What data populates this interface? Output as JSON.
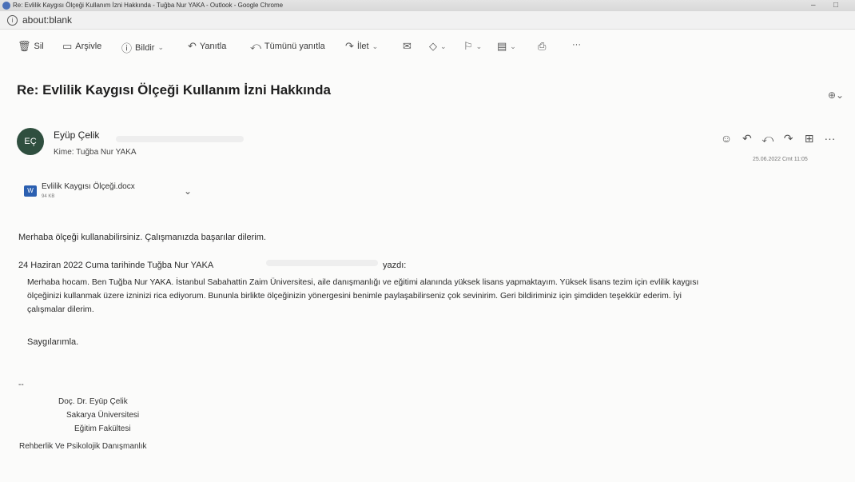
{
  "window": {
    "title": "Re: Evlilik Kaygısı Ölçeği Kullanım İzni Hakkında - Tuğba Nur YAKA - Outlook - Google Chrome",
    "url": "about:blank",
    "minimize": "–",
    "maximize": "□"
  },
  "toolbar": {
    "delete": "Sil",
    "archive": "Arşivle",
    "report": "Bildir",
    "reply": "Yanıtla",
    "reply_all": "Tümünü yanıtla",
    "forward": "İlet",
    "more": "···"
  },
  "mail": {
    "subject": "Re: Evlilik Kaygısı Ölçeği Kullanım İzni Hakkında",
    "avatar_initials": "EÇ",
    "sender": "Eyüp Çelik",
    "to_line": "Kime:  Tuğba Nur YAKA",
    "date": "25.06.2022 Cmt 11:05",
    "attachment": {
      "name": "Evlilik Kaygısı Ölçeği.docx",
      "size": "94 KB"
    },
    "reply_text": "Merhaba ölçeği kullanabilirsiniz. Çalışmanızda başarılar dilerim.",
    "quote_header_start": "24 Haziran 2022 Cuma tarihinde Tuğba Nur YAKA",
    "quote_header_end": "yazdı:",
    "quote_lines": [
      "Merhaba hocam. Ben Tuğba Nur YAKA. İstanbul Sabahattin Zaim Üniversitesi, aile danışmanlığı ve eğitimi alanında yüksek lisans yapmaktayım. Yüksek lisans tezim için evlilik kaygısı",
      "ölçeğinizi kullanmak üzere izninizi rica ediyorum. Bununla birlikte ölçeğinizin yönergesini benimle paylaşabilirseniz çok sevinirim. Geri bildiriminiz için şimdiden teşekkür ederim. İyi",
      "çalışmalar dilerim."
    ],
    "closing": "Saygılarımla.",
    "sig_separator": "--",
    "signature": [
      "Doç. Dr. Eyüp Çelik",
      "Sakarya Üniversitesi",
      "Eğitim Fakültesi",
      "Rehberlik Ve Psikolojik Danışmanlık"
    ]
  },
  "colors": {
    "avatar_bg": "#2f4f3f",
    "doc_icon": "#2b5fb0"
  }
}
